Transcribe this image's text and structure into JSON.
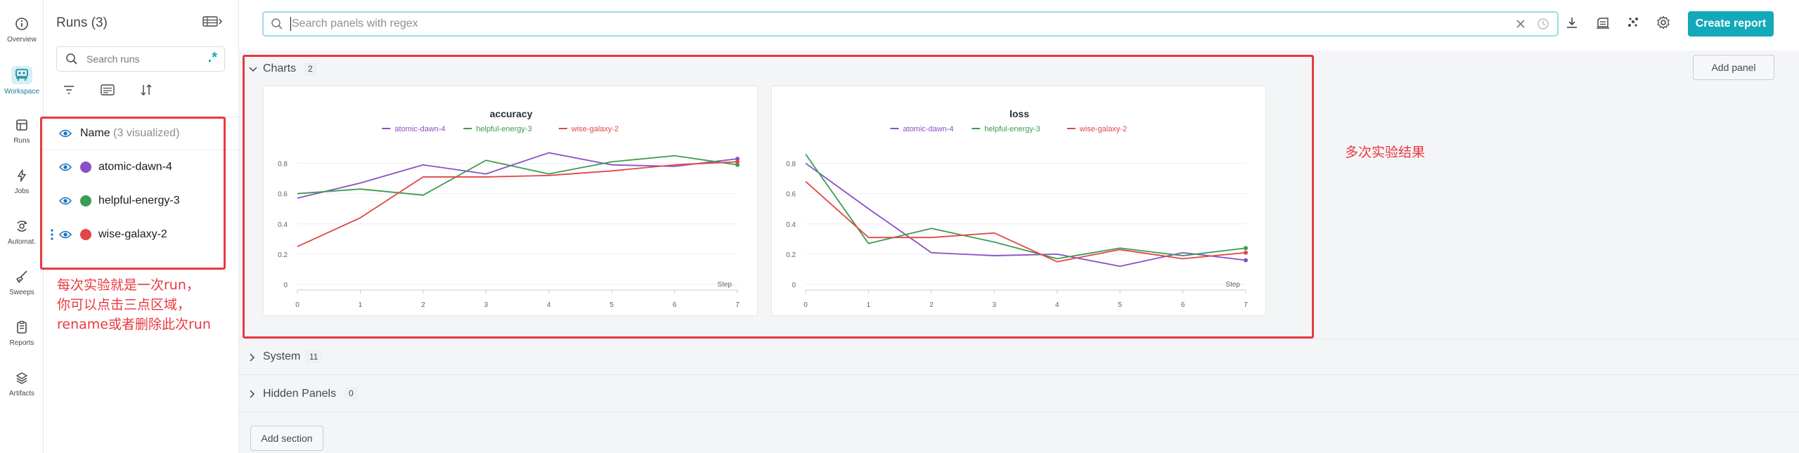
{
  "nav": {
    "items": [
      {
        "label": "Overview",
        "icon": "info-icon"
      },
      {
        "label": "Workspace",
        "icon": "workspace-icon",
        "active": true
      },
      {
        "label": "Runs",
        "icon": "table-icon"
      },
      {
        "label": "Jobs",
        "icon": "lightning-icon"
      },
      {
        "label": "Automat.",
        "icon": "automation-icon"
      },
      {
        "label": "Sweeps",
        "icon": "broom-icon"
      },
      {
        "label": "Reports",
        "icon": "report-icon"
      },
      {
        "label": "Artifacts",
        "icon": "layers-icon"
      }
    ]
  },
  "runs_panel": {
    "title": "Runs (3)",
    "search_placeholder": "Search runs",
    "regex_symbol": ".*",
    "name_header": "Name",
    "name_header_count": "(3 visualized)",
    "runs": [
      {
        "name": "atomic-dawn-4",
        "color": "#8a4fc7"
      },
      {
        "name": "helpful-energy-3",
        "color": "#3d9b52"
      },
      {
        "name": "wise-galaxy-2",
        "color": "#e04646"
      }
    ]
  },
  "top_bar": {
    "search_placeholder": "Search panels with regex",
    "create_report_label": "Create report"
  },
  "sections": {
    "charts": {
      "title": "Charts",
      "count": "2",
      "add_panel_label": "Add panel"
    },
    "system": {
      "title": "System",
      "count": "11"
    },
    "hidden": {
      "title": "Hidden Panels",
      "count": "0"
    },
    "add_section_label": "Add section"
  },
  "annotations": {
    "runs_note": [
      "每次实验就是一次run，",
      "你可以点击三点区域，",
      "rename或者删除此次run"
    ],
    "charts_note": "多次实验结果"
  },
  "colors": {
    "accent": "#13a9ba",
    "annotation": "#e8393f"
  },
  "chart_data": [
    {
      "type": "line",
      "title": "accuracy",
      "xlabel": "Step",
      "x": [
        0,
        1,
        2,
        3,
        4,
        5,
        6,
        7
      ],
      "xlim": [
        0,
        7
      ],
      "ylim": [
        0,
        0.9
      ],
      "yticks": [
        0,
        0.2,
        0.4,
        0.6,
        0.8
      ],
      "legend_position": "top",
      "series": [
        {
          "name": "atomic-dawn-4",
          "color": "#8a4fc7",
          "values": [
            0.57,
            0.67,
            0.79,
            0.73,
            0.87,
            0.79,
            0.78,
            0.83
          ]
        },
        {
          "name": "helpful-energy-3",
          "color": "#3d9b52",
          "values": [
            0.6,
            0.63,
            0.59,
            0.82,
            0.73,
            0.81,
            0.85,
            0.79
          ]
        },
        {
          "name": "wise-galaxy-2",
          "color": "#e04646",
          "values": [
            0.25,
            0.44,
            0.71,
            0.71,
            0.72,
            0.75,
            0.79,
            0.81
          ]
        }
      ]
    },
    {
      "type": "line",
      "title": "loss",
      "xlabel": "Step",
      "x": [
        0,
        1,
        2,
        3,
        4,
        5,
        6,
        7
      ],
      "xlim": [
        0,
        7
      ],
      "ylim": [
        0,
        0.9
      ],
      "yticks": [
        0,
        0.2,
        0.4,
        0.6,
        0.8
      ],
      "legend_position": "top",
      "series": [
        {
          "name": "atomic-dawn-4",
          "color": "#8a4fc7",
          "values": [
            0.8,
            0.5,
            0.21,
            0.19,
            0.2,
            0.12,
            0.21,
            0.16
          ]
        },
        {
          "name": "helpful-energy-3",
          "color": "#3d9b52",
          "values": [
            0.86,
            0.27,
            0.37,
            0.28,
            0.17,
            0.24,
            0.19,
            0.24
          ]
        },
        {
          "name": "wise-galaxy-2",
          "color": "#e04646",
          "values": [
            0.68,
            0.31,
            0.31,
            0.34,
            0.15,
            0.23,
            0.17,
            0.21
          ]
        }
      ]
    }
  ]
}
